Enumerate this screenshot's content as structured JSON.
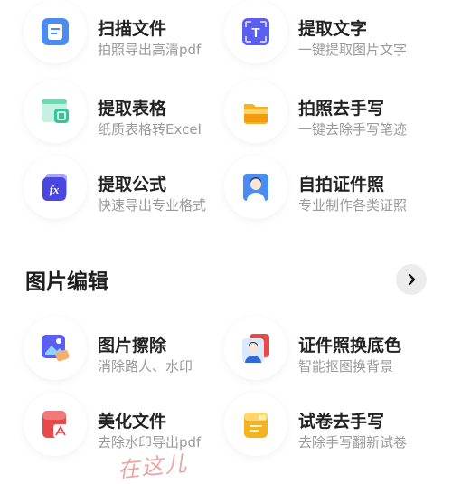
{
  "tools": [
    {
      "title": "扫描文件",
      "subtitle": "拍照导出高清pdf",
      "icon": "scan-document-icon",
      "color": "#4a8cf0"
    },
    {
      "title": "提取文字",
      "subtitle": "一键提取图片文字",
      "icon": "extract-text-icon",
      "color": "#5b5ff0"
    },
    {
      "title": "提取表格",
      "subtitle": "纸质表格转Excel",
      "icon": "extract-table-icon",
      "color": "#35c49a"
    },
    {
      "title": "拍照去手写",
      "subtitle": "一键去除手写笔迹",
      "icon": "remove-handwriting-icon",
      "color": "#f5b324"
    },
    {
      "title": "提取公式",
      "subtitle": "快速导出专业格式",
      "icon": "extract-formula-icon",
      "color": "#4a46e0"
    },
    {
      "title": "自拍证件照",
      "subtitle": "专业制作各类证照",
      "icon": "id-photo-icon",
      "color": "#4a8cf0"
    }
  ],
  "image_edit": {
    "title": "图片编辑",
    "tools": [
      {
        "title": "图片擦除",
        "subtitle": "消除路人、水印",
        "icon": "image-erase-icon",
        "color": "#5b5ff0"
      },
      {
        "title": "证件照换底色",
        "subtitle": "智能抠图换背景",
        "icon": "id-photo-background-icon",
        "color": "#e64a4a"
      },
      {
        "title": "美化文件",
        "subtitle": "去除水印导出pdf",
        "icon": "beautify-document-icon",
        "color": "#e64a4a"
      },
      {
        "title": "试卷去手写",
        "subtitle": "去除手写翻新试卷",
        "icon": "exam-remove-handwriting-icon",
        "color": "#f5b324"
      }
    ]
  },
  "watermark": "在这儿"
}
